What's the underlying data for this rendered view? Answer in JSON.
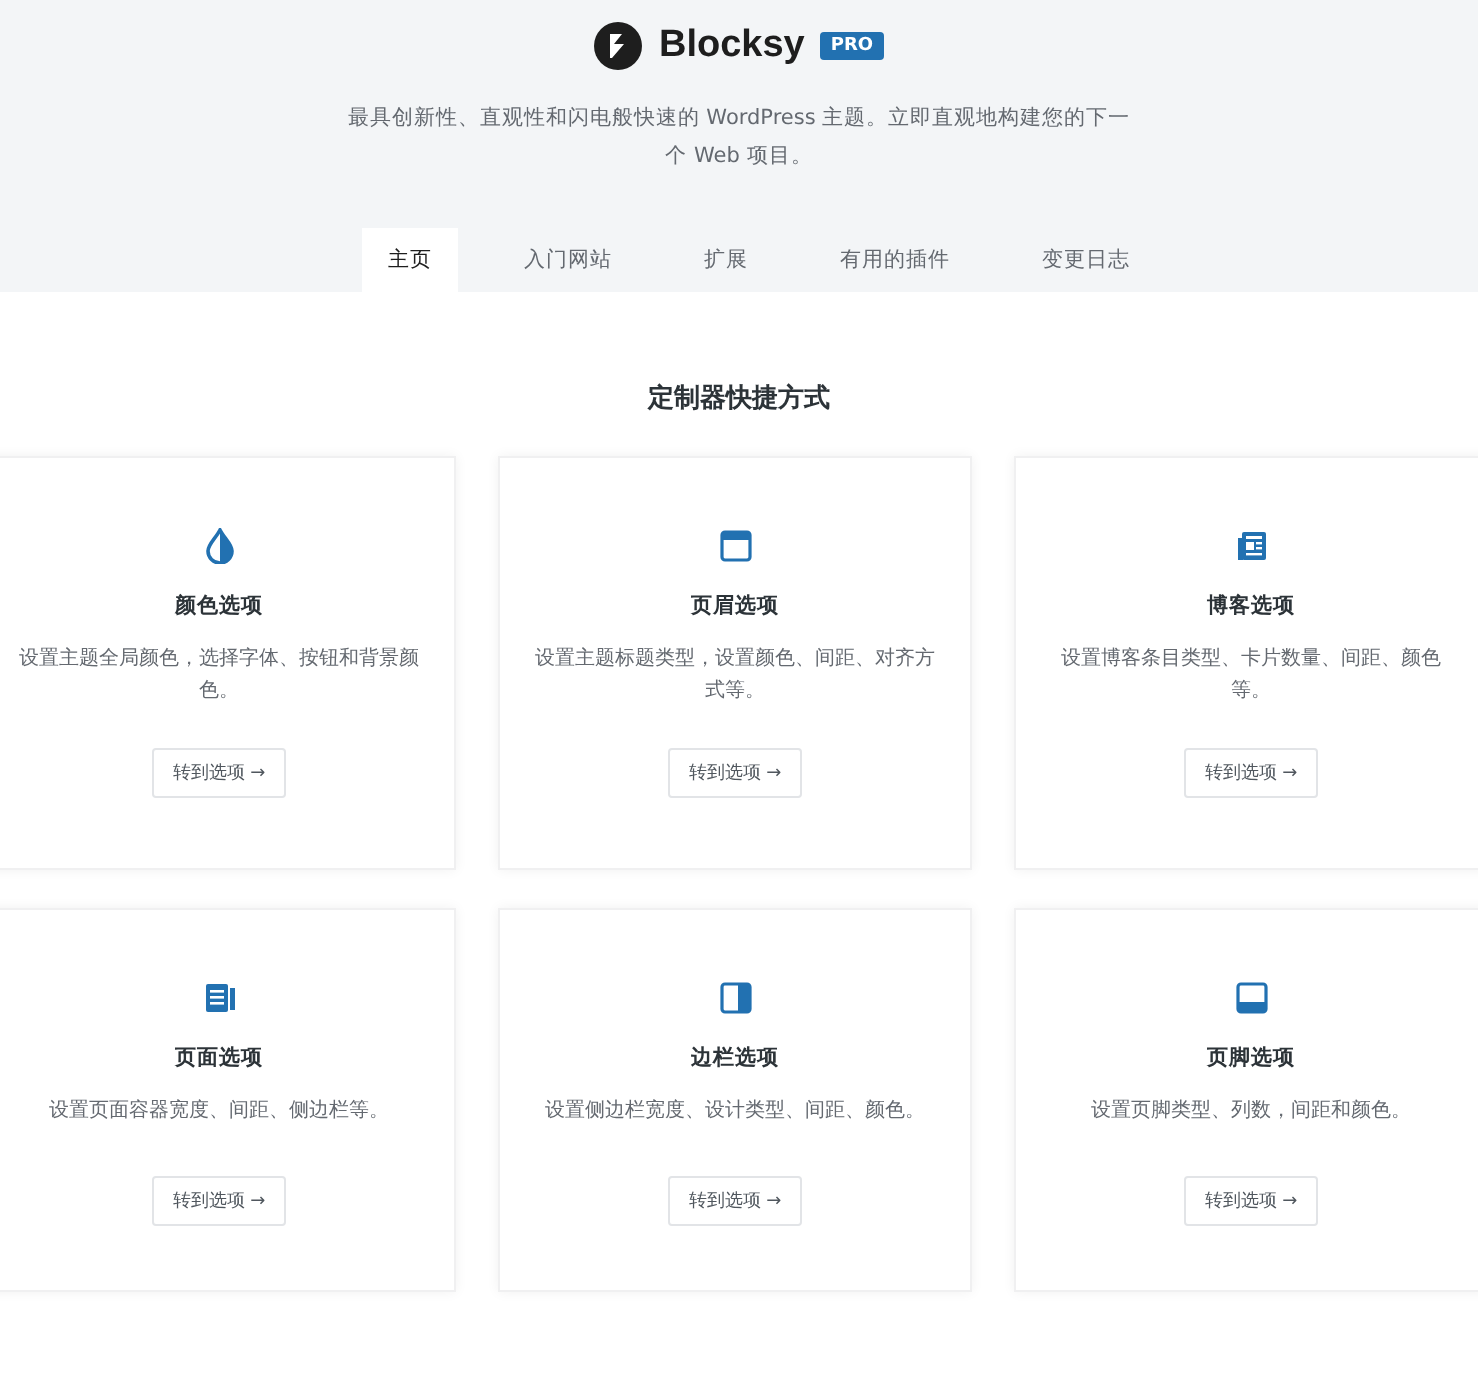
{
  "brand": {
    "name": "Blocksy",
    "badge": "PRO"
  },
  "tagline": "最具创新性、直观性和闪电般快速的 WordPress 主题。立即直观地构建您的下一个 Web 项目。",
  "tabs": [
    {
      "label": "主页",
      "selected": true
    },
    {
      "label": "入门网站",
      "selected": false
    },
    {
      "label": "扩展",
      "selected": false
    },
    {
      "label": "有用的插件",
      "selected": false
    },
    {
      "label": "变更日志",
      "selected": false
    }
  ],
  "section_title": "定制器快捷方式",
  "cards": [
    {
      "kind": "color",
      "title": "颜色选项",
      "description": "设置主题全局颜色，选择字体、按钮和背景颜色。",
      "button": "转到选项 →"
    },
    {
      "kind": "header",
      "title": "页眉选项",
      "description": "设置主题标题类型，设置颜色、间距、对齐方式等。",
      "button": "转到选项 →"
    },
    {
      "kind": "blog",
      "title": "博客选项",
      "description": "设置博客条目类型、卡片数量、间距、颜色等。",
      "button": "转到选项 →"
    },
    {
      "kind": "page",
      "title": "页面选项",
      "description": "设置页面容器宽度、间距、侧边栏等。",
      "button": "转到选项 →"
    },
    {
      "kind": "sidebar",
      "title": "边栏选项",
      "description": "设置侧边栏宽度、设计类型、间距、颜色。",
      "button": "转到选项 →"
    },
    {
      "kind": "footer",
      "title": "页脚选项",
      "description": "设置页脚类型、列数，间距和颜色。",
      "button": "转到选项 →"
    }
  ]
}
